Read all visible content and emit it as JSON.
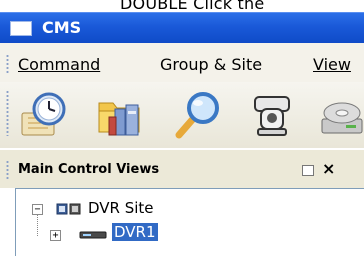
{
  "instruction_text": "DOUBLE Click the ",
  "window": {
    "title": "CMS",
    "icon": "window-icon"
  },
  "menubar": {
    "items": [
      {
        "label": "Command",
        "underline": true
      },
      {
        "label": "Group & Site",
        "underline": false
      },
      {
        "label": "View",
        "underline": true
      }
    ]
  },
  "toolbar": {
    "tools": [
      {
        "icon": "clock-calendar-icon"
      },
      {
        "icon": "folder-settings-icon"
      },
      {
        "icon": "search-magnifier-icon"
      },
      {
        "icon": "camera-settings-icon"
      },
      {
        "icon": "disc-drive-icon"
      }
    ]
  },
  "panel": {
    "title": "Main Control Views",
    "restore_icon": "restore-icon",
    "close_label": "×"
  },
  "tree": {
    "root": {
      "label": "DVR Site",
      "expander": "−",
      "icon": "dvr-site-icon"
    },
    "child": {
      "label": "DVR1",
      "expander": "+",
      "icon": "dvr-device-icon",
      "selected": true
    }
  },
  "colors": {
    "titlebar": "#1a59d8",
    "selection": "#316ac5",
    "menu_bg": "#f4f2ea"
  }
}
